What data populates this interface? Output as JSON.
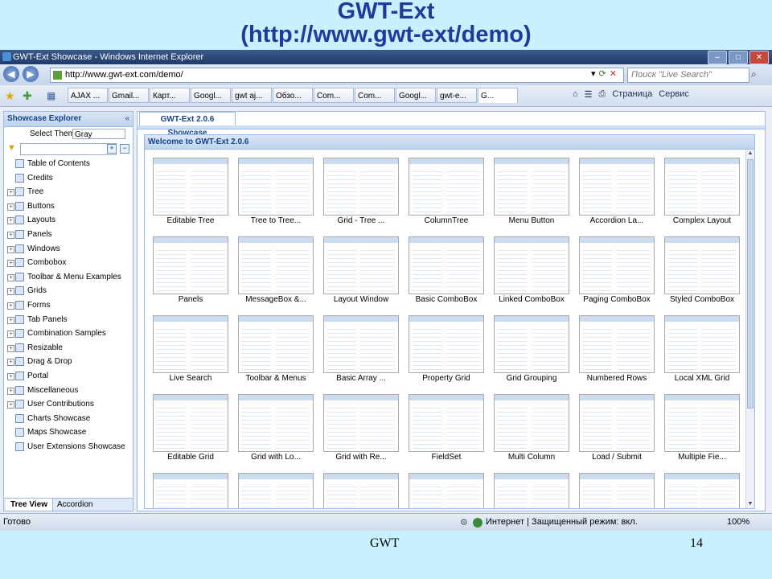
{
  "slide": {
    "title_line1": "GWT-Ext",
    "title_line2": "(http://www.gwt-ext/demo)",
    "footer_left": "GWT",
    "footer_right": "14"
  },
  "browser": {
    "window_title": "GWT-Ext Showcase - Windows Internet Explorer",
    "address": "http://www.gwt-ext.com/demo/",
    "search_placeholder": "Поиск \"Live Search\"",
    "tabs": [
      "AJAX ...",
      "Gmail...",
      "Карт...",
      "Googl...",
      "gwt aj...",
      "Обзо...",
      "Com...",
      "Com...",
      "Googl...",
      "gwt-e...",
      "G..."
    ],
    "tools_page": "Страница",
    "tools_service": "Сервис",
    "status_ready": "Готово",
    "status_zone": "Интернет | Защищенный режим: вкл.",
    "status_zoom": "100%"
  },
  "left_panel": {
    "title": "Showcase Explorer",
    "select_theme_label": "Select Theme",
    "theme_value": "Gray",
    "items": [
      {
        "label": "Table of Contents",
        "expandable": false
      },
      {
        "label": "Credits",
        "expandable": false
      },
      {
        "label": "Tree",
        "expandable": true
      },
      {
        "label": "Buttons",
        "expandable": true
      },
      {
        "label": "Layouts",
        "expandable": true
      },
      {
        "label": "Panels",
        "expandable": true
      },
      {
        "label": "Windows",
        "expandable": true
      },
      {
        "label": "Combobox",
        "expandable": true
      },
      {
        "label": "Toolbar & Menu Examples",
        "expandable": true
      },
      {
        "label": "Grids",
        "expandable": true
      },
      {
        "label": "Forms",
        "expandable": true
      },
      {
        "label": "Tab Panels",
        "expandable": true
      },
      {
        "label": "Combination Samples",
        "expandable": true
      },
      {
        "label": "Resizable",
        "expandable": true
      },
      {
        "label": "Drag & Drop",
        "expandable": true
      },
      {
        "label": "Portal",
        "expandable": true
      },
      {
        "label": "Miscellaneous",
        "expandable": true
      },
      {
        "label": "User Contributions",
        "expandable": true
      },
      {
        "label": "Charts Showcase",
        "expandable": false
      },
      {
        "label": "Maps Showcase",
        "expandable": false
      },
      {
        "label": "User Extensions Showcase",
        "expandable": false
      }
    ],
    "tab_tree_view": "Tree View",
    "tab_accordion": "Accordion"
  },
  "main_panel": {
    "tab_label": "GWT-Ext 2.0.6 Showcase",
    "panel_title": "Welcome to GWT-Ext 2.0.6",
    "thumbnails": [
      "Editable Tree",
      "Tree to Tree...",
      "Grid - Tree ...",
      "ColumnTree",
      "Menu Button",
      "Accordion La...",
      "Complex Layout",
      "Panels",
      "MessageBox &...",
      "Layout Window",
      "Basic ComboBox",
      "Linked ComboBox",
      "Paging ComboBox",
      "Styled ComboBox",
      "Live Search",
      "Toolbar & Menus",
      "Basic Array ...",
      "Property Grid",
      "Grid Grouping",
      "Numbered Rows",
      "Local XML Grid",
      "Editable Grid",
      "Grid with Lo...",
      "Grid with Re...",
      "FieldSet",
      "Multi Column",
      "Load / Submit",
      "Multiple Fie...",
      "",
      "",
      "",
      "",
      "",
      "",
      ""
    ]
  }
}
